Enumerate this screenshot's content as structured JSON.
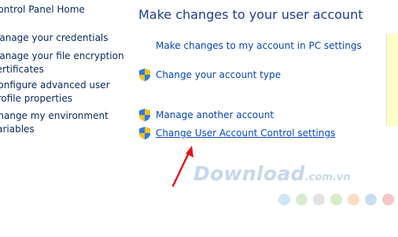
{
  "sidebar": {
    "items": [
      {
        "label": "Control Panel Home"
      },
      {
        "label": "Manage your credentials"
      },
      {
        "label": "Manage your file encryption\ncertificates"
      },
      {
        "label": "Configure advanced user\nprofile properties"
      },
      {
        "label": "Change my environment\nvariables"
      }
    ]
  },
  "main": {
    "title": "Make changes to your user account",
    "links": [
      {
        "label": "Make changes to my account in PC settings"
      },
      {
        "label": "Change your account type"
      },
      {
        "label": "Manage another account"
      },
      {
        "label": "Change User Account Control settings"
      }
    ]
  },
  "watermark": {
    "main_text": "Download",
    "suffix": ".com.vn",
    "dot_colors": [
      "#cfe6f3",
      "#d9ecd2",
      "#e3e3e3",
      "#d7edc3",
      "#fbdcc0",
      "#c9ddf0",
      "#f6c6c6"
    ]
  },
  "annotation": {
    "arrow_color": "#e8141b"
  }
}
